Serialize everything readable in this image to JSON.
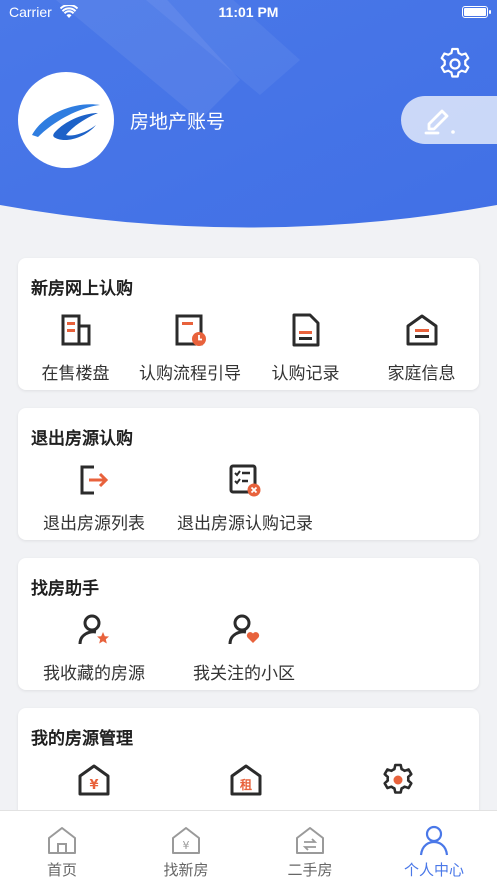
{
  "status_bar": {
    "carrier": "Carrier",
    "time": "11:01 PM"
  },
  "profile": {
    "account_name": "房地产账号"
  },
  "colors": {
    "accent": "#4a78e8",
    "icon_red": "#e8623c",
    "icon_dark": "#2b2b2b"
  },
  "sections": [
    {
      "title": "新房网上认购",
      "items": [
        {
          "label": "在售楼盘",
          "icon": "building-icon"
        },
        {
          "label": "认购流程引导",
          "icon": "process-guide-icon"
        },
        {
          "label": "认购记录",
          "icon": "record-icon"
        },
        {
          "label": "家庭信息",
          "icon": "home-info-icon"
        }
      ]
    },
    {
      "title": "退出房源认购",
      "items": [
        {
          "label": "退出房源列表",
          "icon": "exit-list-icon"
        },
        {
          "label": "退出房源认购记录",
          "icon": "exit-record-icon"
        }
      ]
    },
    {
      "title": "找房助手",
      "items": [
        {
          "label": "我收藏的房源",
          "icon": "favorite-user-icon"
        },
        {
          "label": "我关注的小区",
          "icon": "follow-user-icon"
        }
      ]
    },
    {
      "title": "我的房源管理",
      "items": [
        {
          "label": "",
          "icon": "sell-house-icon",
          "glyph": "¥"
        },
        {
          "label": "",
          "icon": "rent-house-icon",
          "glyph": "租"
        },
        {
          "label": "",
          "icon": "house-settings-icon"
        }
      ]
    }
  ],
  "tabbar": [
    {
      "label": "首页",
      "icon": "home-icon",
      "active": false
    },
    {
      "label": "找新房",
      "icon": "new-house-icon",
      "active": false
    },
    {
      "label": "二手房",
      "icon": "second-hand-icon",
      "active": false
    },
    {
      "label": "个人中心",
      "icon": "profile-icon",
      "active": true
    }
  ]
}
